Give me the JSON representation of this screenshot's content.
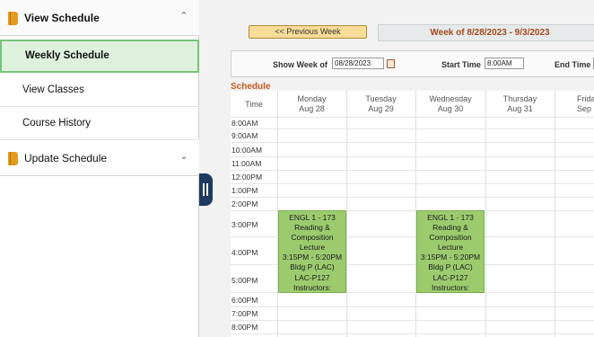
{
  "sidebar": {
    "view_schedule_label": "View Schedule",
    "items": [
      {
        "label": "Weekly Schedule"
      },
      {
        "label": "View Classes"
      },
      {
        "label": "Course History"
      }
    ],
    "update_schedule_label": "Update Schedule"
  },
  "toolbar": {
    "previous_week_label": "<< Previous Week",
    "week_range": "Week of 8/28/2023 - 9/3/2023"
  },
  "options": {
    "show_week_label": "Show Week of",
    "show_week_value": "08/28/2023",
    "start_time_label": "Start Time",
    "start_time_value": "8:00AM",
    "end_time_label": "End Time"
  },
  "schedule": {
    "title": "Schedule",
    "time_header": "Time",
    "days": [
      {
        "day": "Monday",
        "date": "Aug 28"
      },
      {
        "day": "Tuesday",
        "date": "Aug 29"
      },
      {
        "day": "Wednesday",
        "date": "Aug 30"
      },
      {
        "day": "Thursday",
        "date": "Aug 31"
      },
      {
        "day": "Frida",
        "date": "Sep"
      }
    ],
    "times": [
      "8:00AM",
      "9:00AM",
      "10:00AM",
      "11:00AM",
      "12:00PM",
      "1:00PM",
      "2:00PM",
      "3:00PM",
      "4:00PM",
      "5:00PM",
      "6:00PM",
      "7:00PM",
      "8:00PM"
    ],
    "events": [
      {
        "day": "Monday",
        "lines": [
          "ENGL 1 - 173",
          "Reading &",
          "Composition",
          "Lecture",
          "3:15PM - 5:20PM",
          "Bldg P (LAC)",
          "LAC-P127",
          "Instructors:"
        ]
      },
      {
        "day": "Wednesday",
        "lines": [
          "ENGL 1 - 173",
          "Reading &",
          "Composition",
          "Lecture",
          "3:15PM - 5:20PM",
          "Bldg P (LAC)",
          "LAC-P127",
          "Instructors:"
        ]
      }
    ]
  },
  "colors": {
    "event_fill": "#9ccb6e",
    "active_item_fill": "#dff2de",
    "active_item_border": "#78c379",
    "accent_orange": "#c15a1c"
  }
}
